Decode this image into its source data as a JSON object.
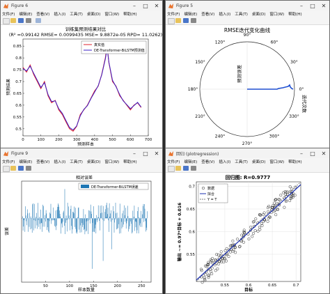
{
  "windows": {
    "w1": {
      "title": "Figure 6",
      "menu": [
        "文件(F)",
        "编辑(E)",
        "查看(V)",
        "插入(I)",
        "工具(T)",
        "桌面(D)",
        "窗口(W)",
        "帮助(H)"
      ],
      "axes_title": "训练集预测结果对比",
      "metrics": "(R² =0.99142 RMSE= 0.0099435 MSE= 9.8872e-05 RPD= 11.0262)",
      "ylabel": "预测结果",
      "xlabel": "预测样本",
      "x_ticks": [
        "0",
        "100",
        "200",
        "300",
        "400",
        "500",
        "600",
        "700"
      ],
      "y_ticks": [
        "0.5",
        "0.55",
        "0.6",
        "0.65",
        "0.7",
        "0.75",
        "0.8",
        "0.85"
      ],
      "legend": [
        "真实值",
        "DE-Transformer-BiLSTM预测值"
      ],
      "colors": {
        "true": "#e0202c",
        "pred": "#3b1fc6"
      }
    },
    "w2": {
      "title": "Figure 5",
      "menu": [
        "文件(F)",
        "编辑(E)",
        "查看(V)",
        "插入(I)",
        "工具(T)",
        "桌面(D)",
        "窗口(W)",
        "帮助(H)"
      ],
      "axes_title": "RMSE迭代变化曲线",
      "angle_labels": [
        "90°",
        "60°",
        "30°",
        "0°",
        "330°",
        "300°",
        "270°",
        "240°",
        "210°",
        "180°",
        "150°",
        "120°"
      ],
      "radial_label": "预测误差",
      "angular_label": "迭代次数"
    },
    "w3": {
      "title": "Figure 9",
      "menu": [
        "文件(F)",
        "编辑(E)",
        "查看(V)",
        "插入(I)",
        "工具(T)",
        "桌面(D)",
        "窗口(W)",
        "帮助(H)"
      ],
      "axes_title": "相对误差",
      "legend": "DE-Transformer-BiLSTM误差",
      "ylabel": "误差",
      "xlabel": "样本数量",
      "x_ticks": [
        "50",
        "100",
        "150",
        "200",
        "250"
      ],
      "color": "#1f77b4"
    },
    "w4": {
      "title": "回归 (plotregression)",
      "menu": [
        "文件(F)",
        "编辑(E)",
        "查看(V)",
        "插入(I)",
        "工具(T)",
        "桌面(D)",
        "窗口(W)",
        "帮助(H)"
      ],
      "axes_title": "回归图: R=0.9777",
      "legend": [
        "数据",
        "拟合",
        "Y = T"
      ],
      "ylabel": "输出 ~= 0.97*目标 + 0.016",
      "xlabel": "目标",
      "x_ticks": [
        "0.55",
        "0.6",
        "0.65",
        "0.7"
      ],
      "y_ticks": [
        "0.55",
        "0.6",
        "0.65",
        "0.7"
      ]
    }
  },
  "chart_data": [
    {
      "type": "line",
      "title": "训练集预测结果对比",
      "xlabel": "预测样本",
      "ylabel": "预测结果",
      "xlim": [
        0,
        700
      ],
      "ylim": [
        0.47,
        0.88
      ],
      "series": [
        {
          "name": "真实值",
          "x": [
            0,
            20,
            40,
            60,
            80,
            100,
            120,
            140,
            160,
            180,
            200,
            220,
            240,
            260,
            280,
            300,
            320,
            340,
            360,
            380,
            400,
            420,
            440,
            460,
            470,
            480,
            500,
            520,
            540,
            560,
            580,
            600,
            620,
            640,
            660
          ],
          "values": [
            0.76,
            0.74,
            0.77,
            0.73,
            0.7,
            0.67,
            0.7,
            0.64,
            0.61,
            0.62,
            0.58,
            0.56,
            0.53,
            0.5,
            0.49,
            0.51,
            0.56,
            0.58,
            0.6,
            0.63,
            0.66,
            0.68,
            0.73,
            0.8,
            0.85,
            0.78,
            0.7,
            0.68,
            0.64,
            0.62,
            0.6,
            0.58,
            0.6,
            0.61,
            0.59
          ]
        },
        {
          "name": "DE-Transformer-BiLSTM预测值",
          "x": [
            0,
            20,
            40,
            60,
            80,
            100,
            120,
            140,
            160,
            180,
            200,
            220,
            240,
            260,
            280,
            300,
            320,
            340,
            360,
            380,
            400,
            420,
            440,
            460,
            470,
            480,
            500,
            520,
            540,
            560,
            580,
            600,
            620,
            640,
            660
          ],
          "values": [
            0.755,
            0.745,
            0.765,
            0.735,
            0.705,
            0.675,
            0.695,
            0.645,
            0.615,
            0.618,
            0.585,
            0.565,
            0.535,
            0.505,
            0.495,
            0.512,
            0.555,
            0.582,
            0.598,
            0.628,
            0.655,
            0.682,
            0.728,
            0.795,
            0.84,
            0.782,
            0.705,
            0.678,
            0.645,
            0.618,
            0.602,
            0.585,
            0.598,
            0.612,
            0.592
          ]
        }
      ]
    },
    {
      "type": "line",
      "title": "RMSE迭代变化曲线",
      "polar": true,
      "theta_labels": [
        "0°",
        "30°",
        "60°",
        "90°",
        "120°",
        "150°",
        "180°",
        "210°",
        "240°",
        "270°",
        "300°",
        "330°"
      ],
      "radial_axis_label": "预测误差",
      "angular_axis_label": "迭代次数"
    },
    {
      "type": "bar",
      "title": "相对误差",
      "xlabel": "样本数量",
      "ylabel": "误差",
      "xlim": [
        0,
        270
      ],
      "ylim": [
        -0.12,
        0.07
      ],
      "series": [
        {
          "name": "DE-Transformer-BiLSTM误差"
        }
      ]
    },
    {
      "type": "scatter",
      "title": "回归图: R=0.9777",
      "xlabel": "目标",
      "ylabel": "输出 ~= 0.97*目标 + 0.016",
      "xlim": [
        0.49,
        0.71
      ],
      "ylim": [
        0.49,
        0.71
      ],
      "fit": {
        "slope": 0.97,
        "intercept": 0.016
      },
      "series": [
        {
          "name": "数据"
        },
        {
          "name": "拟合"
        },
        {
          "name": "Y = T"
        }
      ]
    }
  ]
}
